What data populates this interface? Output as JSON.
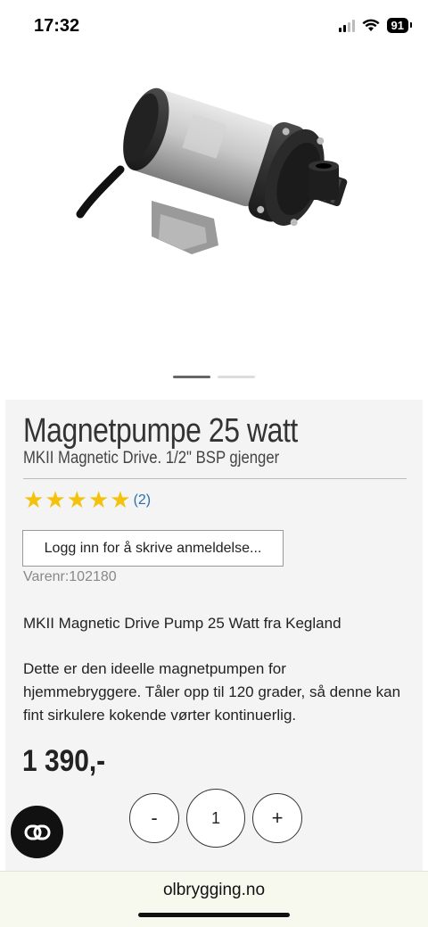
{
  "status_bar": {
    "time": "17:32",
    "battery": "91",
    "icons": [
      "cellular-signal-icon",
      "wifi-icon",
      "battery-icon"
    ]
  },
  "product": {
    "image": "magnetic-drive-pump-image",
    "title": "Magnetpumpe 25 watt",
    "subtitle": "MKII Magnetic Drive. 1/2\" BSP gjenger",
    "rating": {
      "stars": 5,
      "max": 5,
      "count": "(2)"
    },
    "review_button": "Logg inn for å skrive anmeldelse...",
    "sku_label": "Varenr:",
    "sku": "102180",
    "description_1": "MKII Magnetic Drive Pump 25 Watt fra Kegland",
    "description_2": "Dette er den ideelle magnetpumpen for hjemmebryggere. Tåler opp til 120 grader, så denne kan fint sirkulere kokende vørter kontinuerlig.",
    "price": "1 390,-"
  },
  "carousel": {
    "count": 2,
    "active": 1
  },
  "quantity": {
    "minus": "-",
    "value": "1",
    "plus": "+"
  },
  "chat_button": {
    "icon": "chat-link-icon"
  },
  "browser": {
    "url": "olbrygging.no"
  },
  "colors": {
    "star": "#f4c20d",
    "link": "#2a6fb0",
    "panel_bg": "#f4f4f4"
  }
}
